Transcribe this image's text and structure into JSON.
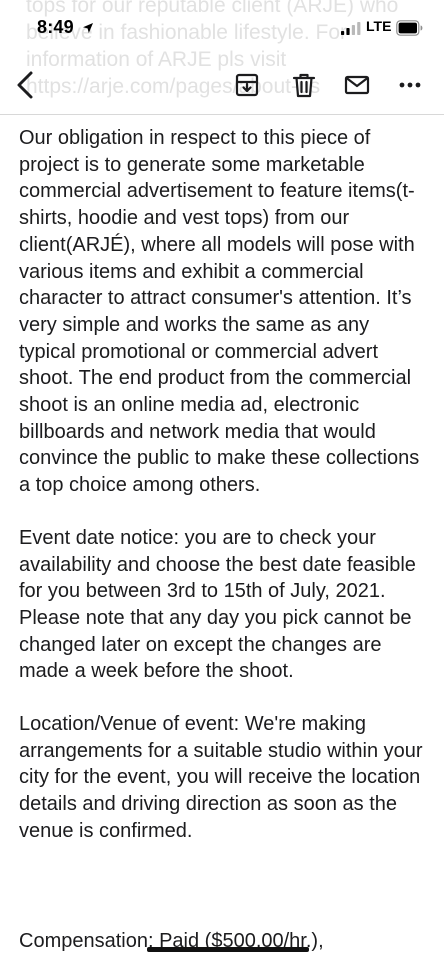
{
  "ghost_header": {
    "lines": [
      "tops for our reputable client (ARJE) who",
      "believe in fashionable lifestyle. For",
      "information of ARJE pls visit",
      "https://arje.com/pages/about-us"
    ]
  },
  "status_bar": {
    "time": "8:49",
    "network": "LTE"
  },
  "toolbar": {
    "back_icon": "chevron-left-icon",
    "archive_icon": "archive-icon",
    "trash_icon": "trash-icon",
    "mail_icon": "envelope-icon",
    "more_icon": "more-horizontal-icon"
  },
  "email_body": {
    "paragraphs": [
      "Our obligation in respect to this piece of project is to generate some marketable commercial advertisement to feature items(t-shirts, hoodie and vest tops) from our client(ARJÉ), where all models will pose with various items and exhibit a commercial character to attract consumer's attention. It’s very simple and works the same as any typical promotional or commercial advert shoot. The end product from the commercial shoot is an online media ad, electronic billboards and network media that would convince the public to make these collections a top choice among others.",
      "Event date notice: you are to check your availability and choose the best date feasible for you between 3rd to 15th of July, 2021. Please note that any day you pick cannot be changed later on except the changes are made a week before the shoot.",
      "Location/Venue of event: We're making arrangements for a suitable studio within your city for the event, you will receive the location details and driving direction as soon as the venue is confirmed."
    ],
    "compensation": "Compensation: Paid ($500.00/hr.),"
  },
  "colors": {
    "accent": "#1c1c1e",
    "separator": "#d8d8d8"
  }
}
